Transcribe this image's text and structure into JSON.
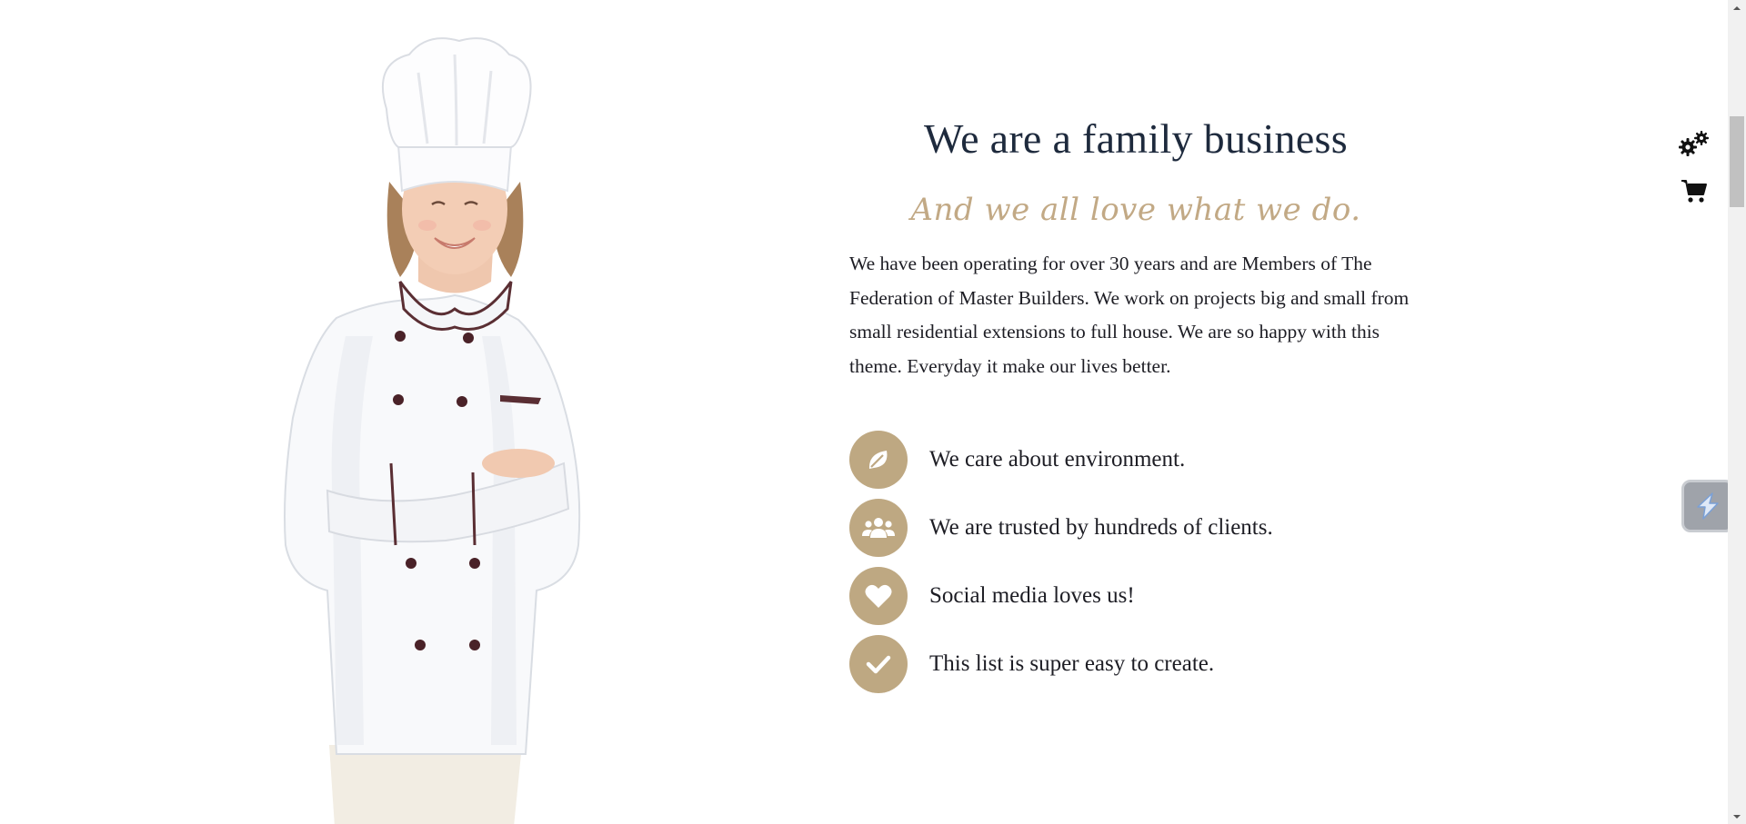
{
  "about": {
    "heading": "We are a family business",
    "subheading": "And we all love what we do.",
    "paragraph": "We have been operating for over 30 years and are Members of The Federation of Master Builders. We work on projects big and small from small residential extensions to full house. We are so happy with this theme. Everyday it make our lives better."
  },
  "features": [
    {
      "icon": "leaf-icon",
      "text": "We care about environment."
    },
    {
      "icon": "users-icon",
      "text": "We are trusted by hundreds of clients."
    },
    {
      "icon": "heart-icon",
      "text": "Social media loves us!"
    },
    {
      "icon": "checkmark-icon",
      "text": "This list is super easy to create."
    }
  ],
  "tools": {
    "settings_icon": "gears-icon",
    "cart_icon": "shopping-cart-icon",
    "floating_button_icon": "lightning-icon"
  },
  "colors": {
    "accent": "#bea882",
    "heading": "#1e2a3d",
    "subheading": "#c2a985",
    "text": "#1d1d24"
  }
}
